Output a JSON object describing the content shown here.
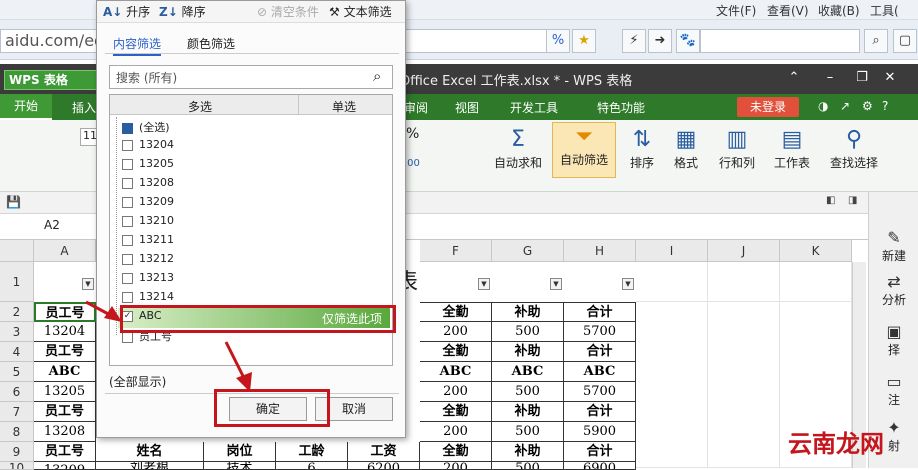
{
  "browser": {
    "menu": [
      "文件(F)",
      "查看(V)",
      "收藏(B)",
      "工具("
    ],
    "address_text": "aidu.com/edi"
  },
  "wps": {
    "logo": "WPS 表格",
    "doc_title": "Office Excel 工作表.xlsx * - WPS 表格",
    "tabs": [
      "开始",
      "插入",
      "审阅",
      "视图",
      "开发工具",
      "特色功能"
    ],
    "login": "未登录"
  },
  "ribbon": {
    "font_size": "11",
    "buttons": [
      "自动求和",
      "自动筛选",
      "排序",
      "格式",
      "行和列",
      "工作表",
      "查找选择"
    ],
    "icons": [
      "sum-icon",
      "filter-icon",
      "sort-icon",
      "format-icon",
      "rows-cols-icon",
      "sheet-icon",
      "find-icon"
    ]
  },
  "formula_bar": {
    "namebox": "A2"
  },
  "columns": [
    "A",
    "F",
    "G",
    "H",
    "I",
    "J",
    "K"
  ],
  "rows": [
    "1",
    "2",
    "3",
    "4",
    "5",
    "6",
    "7",
    "8",
    "9",
    "10"
  ],
  "sheet_title_fragment": "表",
  "table": {
    "col_A": [
      "员工号",
      "13204",
      "员工号",
      "ABC",
      "13205",
      "员工号",
      "13208",
      "员工号",
      "13209"
    ],
    "col_F": [
      "全勤",
      "200",
      "全勤",
      "ABC",
      "200",
      "全勤",
      "200",
      "全勤",
      "200"
    ],
    "col_G": [
      "补助",
      "500",
      "补助",
      "ABC",
      "500",
      "补助",
      "500",
      "补助",
      "500"
    ],
    "col_H": [
      "合计",
      "5700",
      "合计",
      "ABC",
      "5700",
      "合计",
      "5900",
      "合计",
      "6900"
    ],
    "row9_mid": [
      "姓名",
      "岗位",
      "工龄",
      "工资"
    ],
    "row10_mid": [
      "刘老根",
      "技术",
      "6",
      "6200"
    ]
  },
  "sidebar": [
    "新建",
    "分析",
    "择",
    "注",
    "射"
  ],
  "popup": {
    "sort_asc": "升序",
    "sort_desc": "降序",
    "clear": "清空条件",
    "text_filter": "文本筛选",
    "tab_content": "内容筛选",
    "tab_color": "颜色筛选",
    "search_placeholder": "搜索 (所有)",
    "col_multi": "多选",
    "col_single": "单选",
    "items": [
      "(全选)",
      "13204",
      "13205",
      "13208",
      "13209",
      "13210",
      "13211",
      "13212",
      "13213",
      "13214",
      "ABC",
      "员工号"
    ],
    "only_this": "仅筛选此项",
    "show_all": "(全部显示)",
    "ok": "确定",
    "cancel": "取消"
  },
  "watermark": "云南龙网",
  "colors": {
    "wps_green": "#2f7a2a",
    "highlight_green": "#5aa83c",
    "annotation_red": "#c4161c"
  }
}
